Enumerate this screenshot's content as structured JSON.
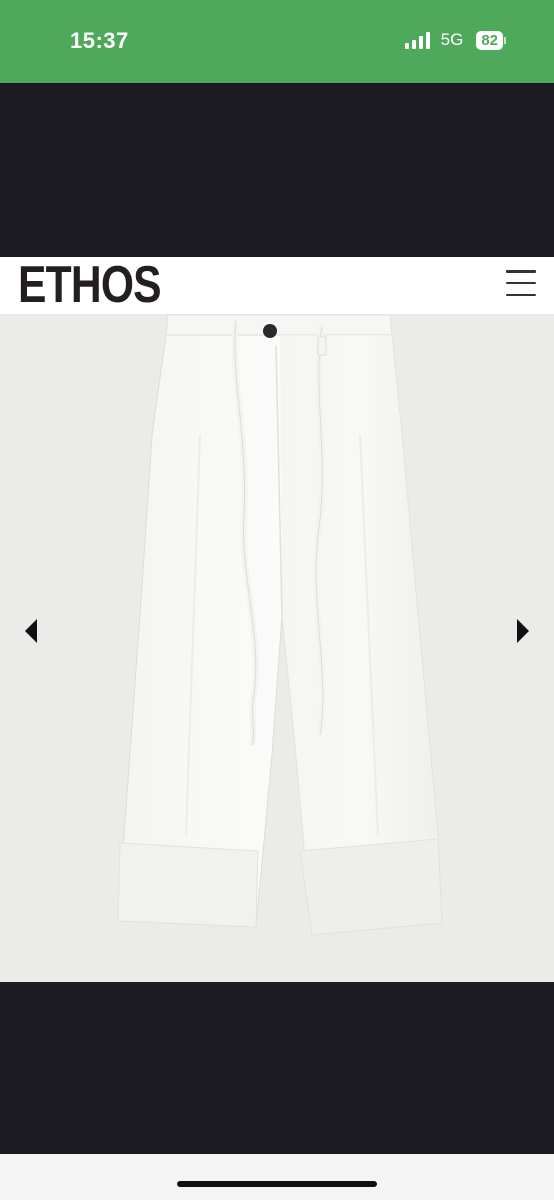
{
  "status_bar": {
    "time": "15:37",
    "network": "5G",
    "battery": "82",
    "background_color": "#4fa95a"
  },
  "header": {
    "logo_text": "ETHOS",
    "menu_icon": "hamburger-menu-icon"
  },
  "carousel": {
    "product_image": "white wide-leg trousers with drawstring ties",
    "prev_icon": "triangle-left-icon",
    "next_icon": "triangle-right-icon"
  },
  "colors": {
    "page_dark": "#1c1b22",
    "image_background": "#ebebe9",
    "header_background": "#ffffff"
  }
}
